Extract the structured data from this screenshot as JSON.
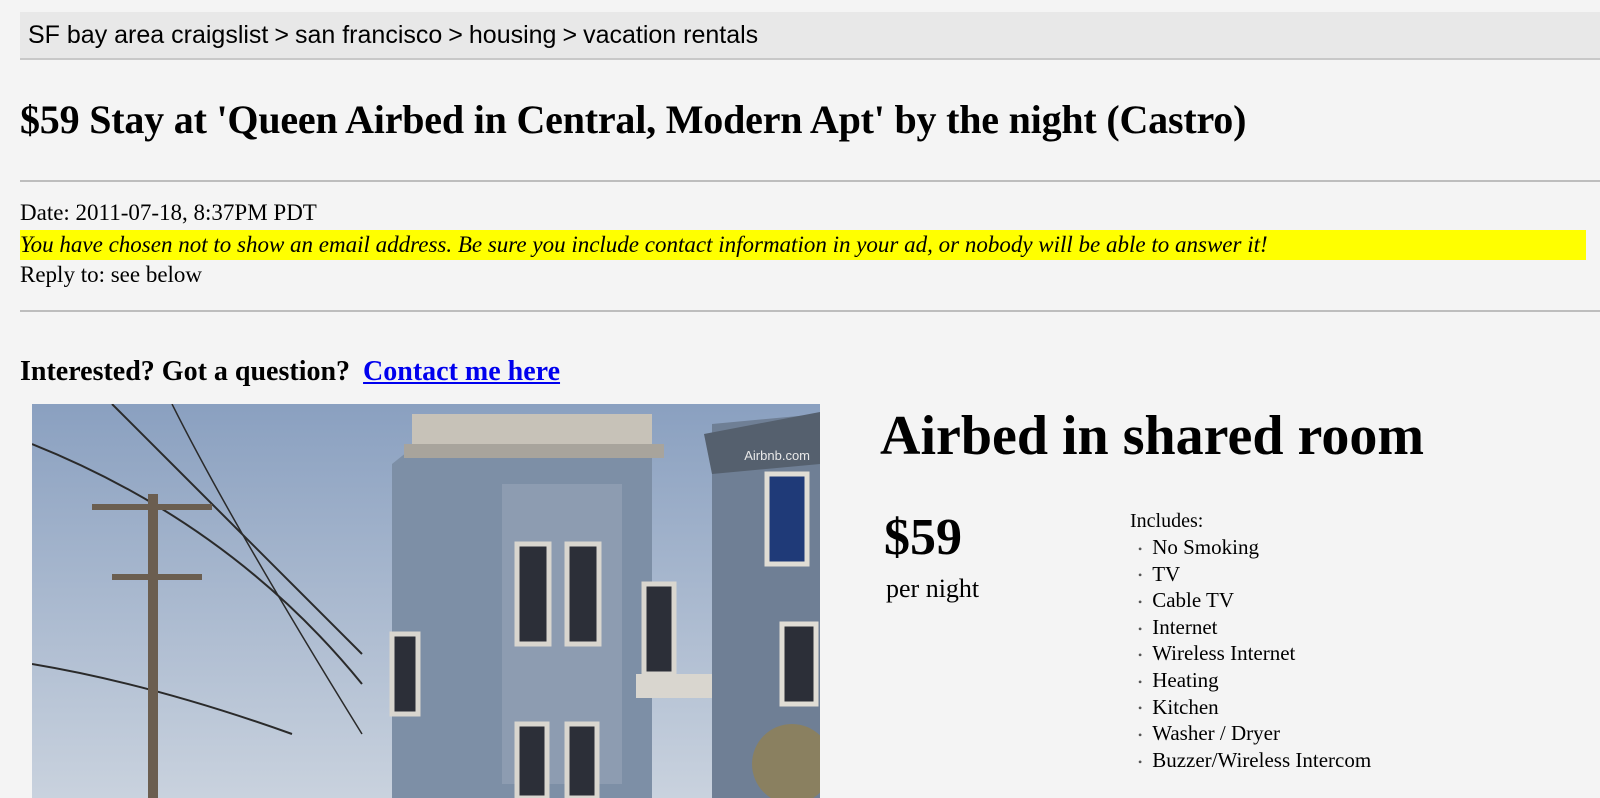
{
  "breadcrumb": {
    "items": [
      "SF bay area craigslist",
      "san francisco",
      "housing",
      "vacation rentals"
    ],
    "separator": ">"
  },
  "post": {
    "title": "$59 Stay at 'Queen Airbed in Central, Modern Apt' by the night (Castro)",
    "date": "Date: 2011-07-18, 8:37PM PDT",
    "warning": "You have chosen not to show an email address. Be sure you include contact information in your ad, or nobody will be able to answer it!",
    "reply": "Reply to: see below"
  },
  "contact": {
    "question": "Interested? Got a question?",
    "link_label": "Contact me here"
  },
  "photo": {
    "watermark": "Airbnb.com"
  },
  "listing": {
    "heading": "Airbed in shared room",
    "price": "$59",
    "price_unit": "per night",
    "includes_label": "Includes:",
    "amenities": [
      "No Smoking",
      "TV",
      "Cable TV",
      "Internet",
      "Wireless Internet",
      "Heating",
      "Kitchen",
      "Washer / Dryer",
      "Buzzer/Wireless Intercom"
    ]
  },
  "colors": {
    "highlight": "#ffff00",
    "link": "#0000ee",
    "background": "#f4f4f4"
  }
}
